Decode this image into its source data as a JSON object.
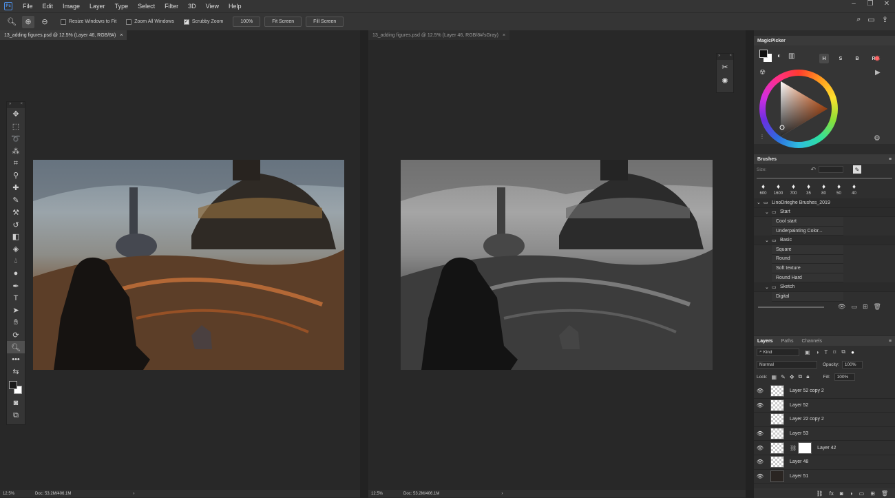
{
  "app": {
    "logo": "Ps"
  },
  "menu": [
    "File",
    "Edit",
    "Image",
    "Layer",
    "Type",
    "Select",
    "Filter",
    "3D",
    "View",
    "Help"
  ],
  "window_controls": [
    "–",
    "❐",
    "✕"
  ],
  "options_bar": {
    "resize_windows": "Resize Windows to Fit",
    "zoom_all": "Zoom All Windows",
    "scrubby_zoom": "Scrubby Zoom",
    "zoom_value": "100%",
    "fit_screen": "Fit Screen",
    "fill_screen": "Fill Screen"
  },
  "documents": [
    {
      "tab": "13_adding figures.psd @ 12.5% (Layer 46, RGB/8#)",
      "close": "×",
      "zoom": "12.5%",
      "doc": "Doc: 53.2M/406.1M"
    },
    {
      "tab": "13_adding figures.psd @ 12.5% (Layer 46, RGB/8#/sGray)",
      "close": "×",
      "zoom": "12.5%",
      "doc": "Doc: 53.2M/406.1M"
    }
  ],
  "magicpicker": {
    "title": "MagicPicker",
    "modes": [
      "H",
      "S",
      "B",
      "R"
    ]
  },
  "brushes": {
    "title": "Brushes",
    "size_label": "Size:",
    "presets": [
      "600",
      "1600",
      "700",
      "35",
      "80",
      "50",
      "40"
    ],
    "tree": [
      {
        "label": "LinoDrieghe Brushes_2019",
        "type": "folder",
        "depth": 0
      },
      {
        "label": "Start",
        "type": "folder",
        "depth": 1
      },
      {
        "label": "Cool start",
        "type": "leaf"
      },
      {
        "label": "Underpainting Color...",
        "type": "leaf"
      },
      {
        "label": "Basic",
        "type": "folder",
        "depth": 1
      },
      {
        "label": "Square",
        "type": "leaf"
      },
      {
        "label": "Round",
        "type": "leaf"
      },
      {
        "label": "Soft texture",
        "type": "leaf"
      },
      {
        "label": "Round Hard",
        "type": "leaf"
      },
      {
        "label": "Sketch",
        "type": "folder",
        "depth": 1
      },
      {
        "label": "Digital",
        "type": "leaf"
      }
    ]
  },
  "layers_panel": {
    "tabs": [
      "Layers",
      "Paths",
      "Channels"
    ],
    "kind": "Kind",
    "blend_mode": "Normal",
    "opacity_label": "Opacity:",
    "opacity": "100%",
    "lock_label": "Lock:",
    "fill_label": "Fill:",
    "fill": "100%",
    "layers": [
      {
        "name": "Layer 52 copy 2",
        "visible": true,
        "thumb": "transparent"
      },
      {
        "name": "Layer 52",
        "visible": true,
        "thumb": "transparent"
      },
      {
        "name": "Layer 22 copy 2",
        "visible": false,
        "thumb": "transparent"
      },
      {
        "name": "Layer 53",
        "visible": true,
        "thumb": "transparent"
      },
      {
        "name": "Layer 42",
        "visible": true,
        "thumb": "mask"
      },
      {
        "name": "Layer 48",
        "visible": true,
        "thumb": "transparent"
      },
      {
        "name": "Layer 51",
        "visible": true,
        "thumb": "dark"
      }
    ]
  }
}
